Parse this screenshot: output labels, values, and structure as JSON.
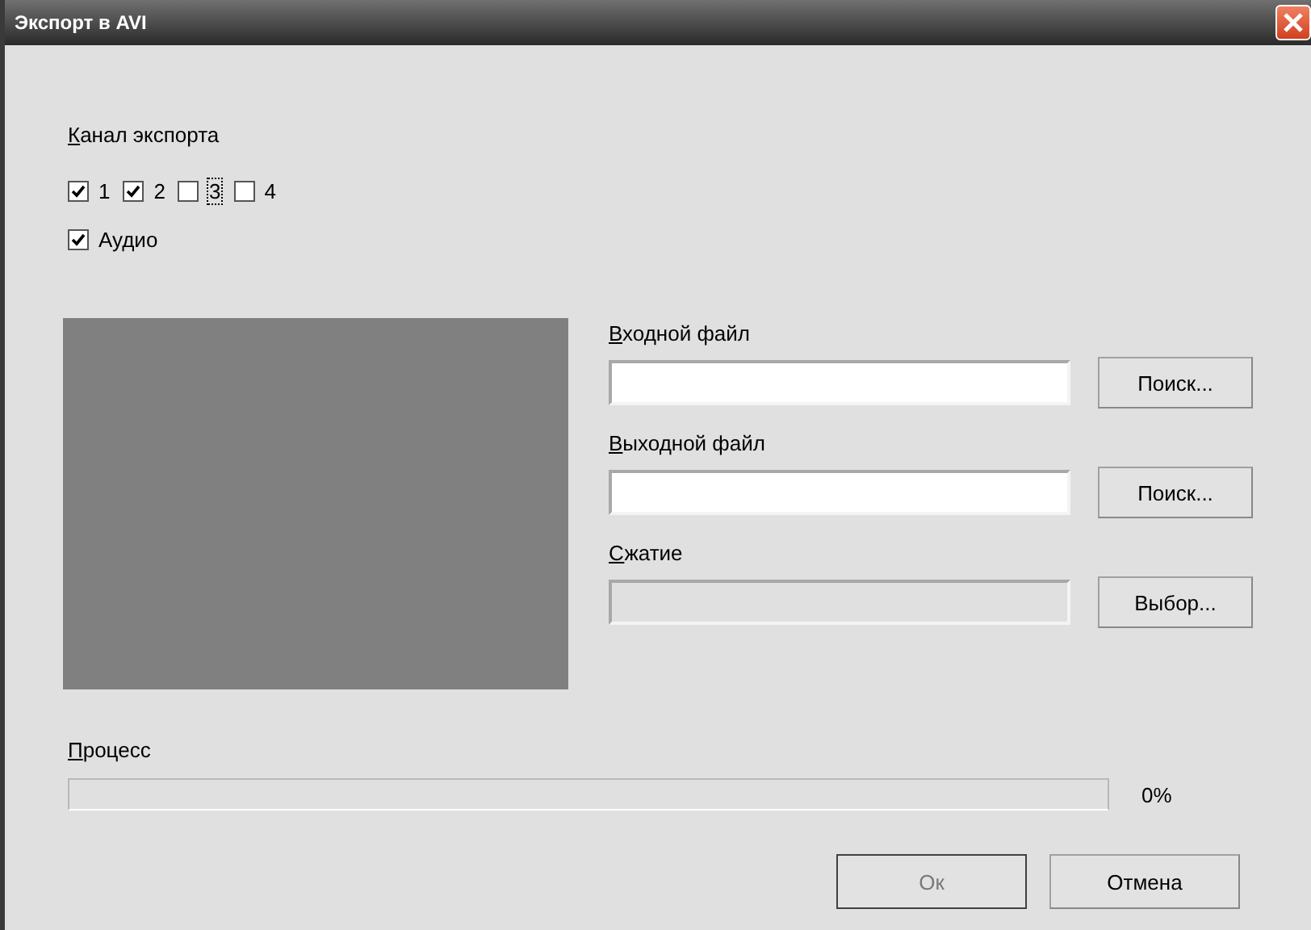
{
  "window": {
    "title": "Экспорт в AVI"
  },
  "channels_label": "Канал экспорта",
  "channels": [
    {
      "label": "1",
      "checked": true,
      "focused": false
    },
    {
      "label": "2",
      "checked": true,
      "focused": false
    },
    {
      "label": "3",
      "checked": false,
      "focused": true
    },
    {
      "label": "4",
      "checked": false,
      "focused": false
    }
  ],
  "audio": {
    "label": "Аудио",
    "checked": true
  },
  "preview": {
    "kind": "video"
  },
  "fields": [
    {
      "label": "Входной файл",
      "button": "Поиск...",
      "disabled": false
    },
    {
      "label": "Выходной файл",
      "button": "Поиск...",
      "disabled": false
    },
    {
      "label": "Сжатие",
      "button": "Выбор...",
      "disabled": true
    }
  ],
  "progress": {
    "label": "Процесс",
    "level": 0,
    "reading": "0%"
  },
  "buttons": [
    {
      "label": "Ок",
      "disabled": true
    },
    {
      "label": "Отмена",
      "disabled": false
    }
  ]
}
